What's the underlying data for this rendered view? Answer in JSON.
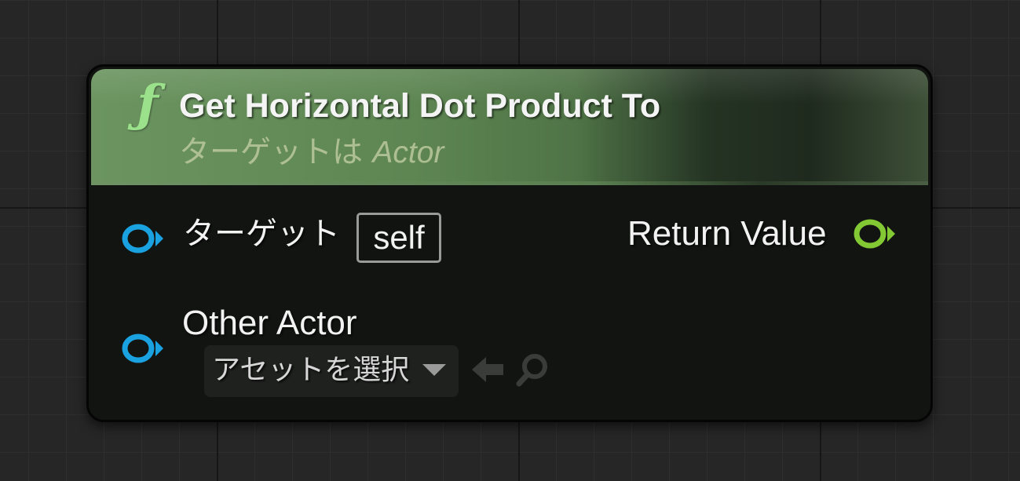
{
  "node": {
    "title": "Get Horizontal Dot Product To",
    "icon": "function-icon",
    "icon_glyph": "ƒ",
    "subtitle_prefix": "ターゲットは ",
    "subtitle_class": "Actor",
    "header_color": "#5e8653"
  },
  "inputs": [
    {
      "label": "ターゲット",
      "default_value": "self",
      "pin_color": "#1aa2e0"
    },
    {
      "label": "Other Actor",
      "asset_picker": {
        "placeholder": "アセットを選択",
        "icons": [
          "use-selected-arrow-icon",
          "browse-search-icon"
        ]
      },
      "pin_color": "#1aa2e0"
    }
  ],
  "outputs": [
    {
      "label": "Return Value",
      "pin_color": "#82c934"
    }
  ]
}
